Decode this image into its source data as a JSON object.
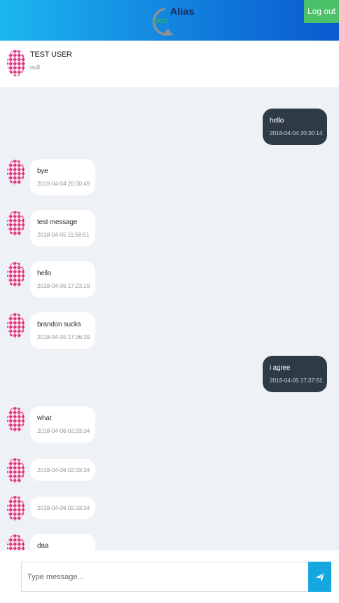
{
  "header": {
    "app_name": "Alias",
    "logout_label": "Log out",
    "brand_colors": {
      "start": "#1bb7f0",
      "end": "#0b59cf"
    },
    "logout_color": "#4bc26a"
  },
  "contact": {
    "name": "TEST USER",
    "status": "null",
    "avatar_icon": "pink-pattern-avatar-icon"
  },
  "messages": [
    {
      "direction": "out",
      "text": "hello",
      "time": "2018-04-04 20:30:14"
    },
    {
      "direction": "in",
      "text": "bye",
      "time": "2018-04-04 20:30:49"
    },
    {
      "direction": "in",
      "text": "test message",
      "time": "2018-04-05 11:58:51"
    },
    {
      "direction": "in",
      "text": "hello",
      "time": "2018-04-05 17:23:19"
    },
    {
      "direction": "in",
      "text": "brandon sucks",
      "time": "2018-04-05 17:36:39"
    },
    {
      "direction": "out",
      "text": "i agree",
      "time": "2018-04-05 17:37:51"
    },
    {
      "direction": "in",
      "text": "what",
      "time": "2018-04-06 02:33:34"
    },
    {
      "direction": "in",
      "text": "",
      "time": "2018-04-06 02:33:34"
    },
    {
      "direction": "in",
      "text": "",
      "time": "2018-04-06 02:33:34"
    },
    {
      "direction": "in",
      "text": "daa",
      "time": ""
    }
  ],
  "composer": {
    "placeholder": "Type message...",
    "value": "",
    "send_icon": "paper-plane-icon",
    "send_color": "#14a7e0"
  }
}
